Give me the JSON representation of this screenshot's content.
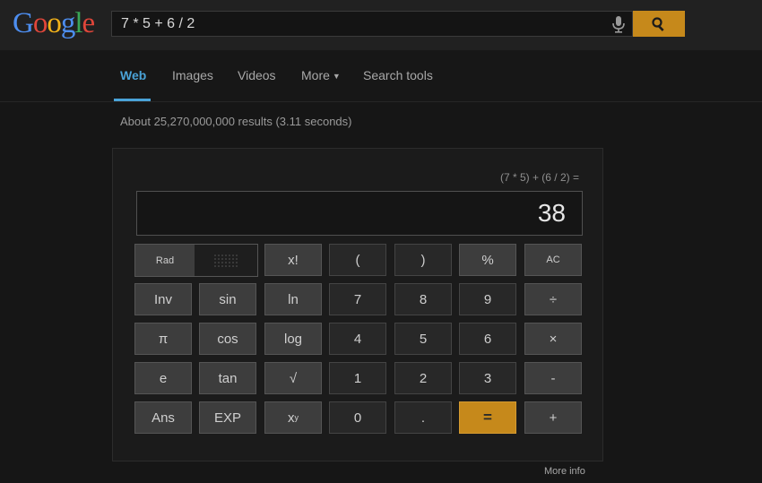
{
  "header": {
    "logo_letters": [
      {
        "ch": "G",
        "color": "#4d8ef0"
      },
      {
        "ch": "o",
        "color": "#e0463a"
      },
      {
        "ch": "o",
        "color": "#f2b21a"
      },
      {
        "ch": "g",
        "color": "#4d8ef0"
      },
      {
        "ch": "l",
        "color": "#3aa757"
      },
      {
        "ch": "e",
        "color": "#e0463a"
      }
    ],
    "query": "7 * 5 + 6 / 2",
    "mic_icon": "microphone-icon",
    "search_icon": "search-icon",
    "search_button_color": "#c6891b"
  },
  "nav": {
    "tabs": [
      {
        "label": "Web",
        "active": true
      },
      {
        "label": "Images"
      },
      {
        "label": "Videos"
      },
      {
        "label": "More"
      },
      {
        "label": "Search tools"
      }
    ],
    "accent": "#4aa3d8"
  },
  "results": {
    "stats": "About 25,270,000,000 results (3.11 seconds)"
  },
  "calculator": {
    "expression": "(7 * 5) + (6 / 2) =",
    "display": "38",
    "mode_rad": "Rad",
    "keys": {
      "fact": "x!",
      "lparen": "(",
      "rparen": ")",
      "percent": "%",
      "ac": "AC",
      "inv": "Inv",
      "sin": "sin",
      "ln": "ln",
      "k7": "7",
      "k8": "8",
      "k9": "9",
      "divide": "÷",
      "pi": "π",
      "cos": "cos",
      "log": "log",
      "k4": "4",
      "k5": "5",
      "k6": "6",
      "multiply": "×",
      "e": "e",
      "tan": "tan",
      "sqrt": "√",
      "k1": "1",
      "k2": "2",
      "k3": "3",
      "minus": "-",
      "ans": "Ans",
      "exp": "EXP",
      "k0": "0",
      "dot": ".",
      "equals": "=",
      "plus": "+"
    },
    "pow_base": "x",
    "pow_exp": "y",
    "more_info": "More info"
  }
}
